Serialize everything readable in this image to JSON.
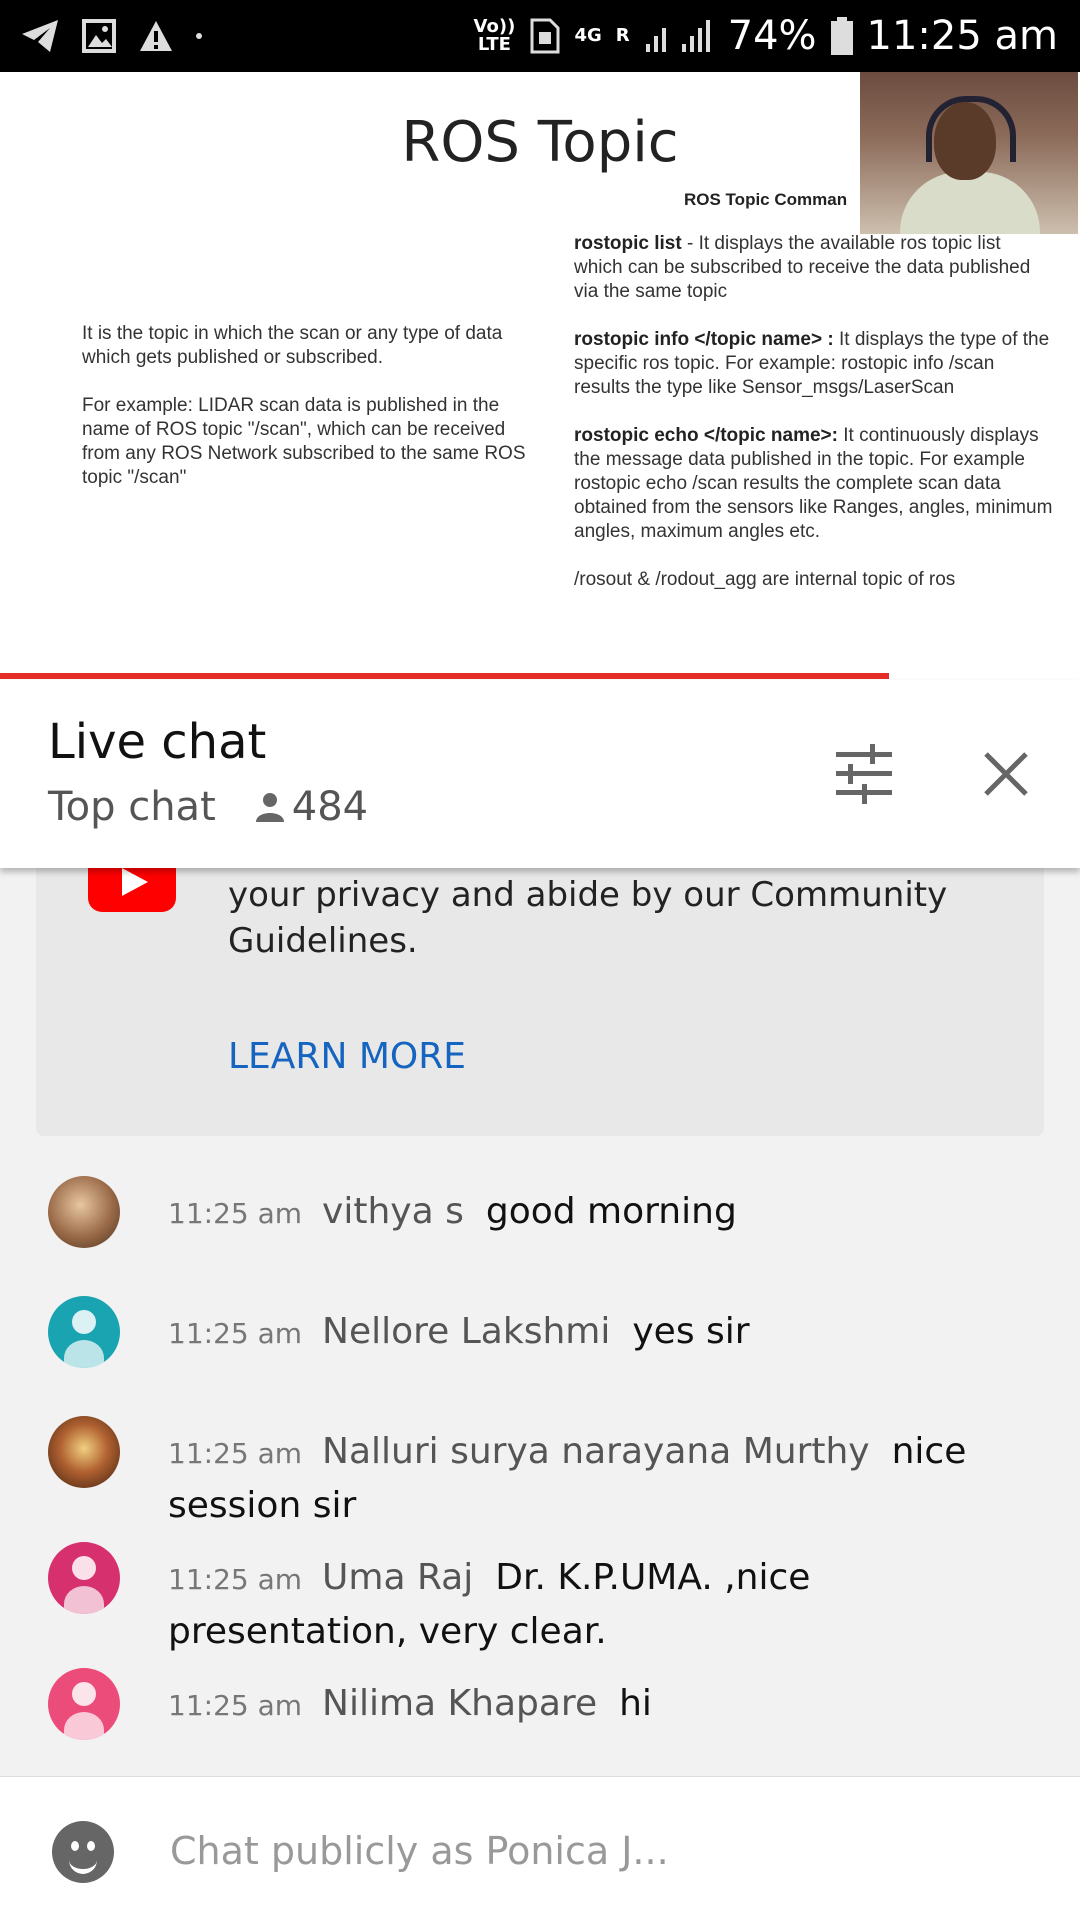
{
  "status_bar": {
    "signal_labels": [
      "Vo)) LTE",
      "4G",
      "R"
    ],
    "battery": "74%",
    "time": "11:25 am"
  },
  "video": {
    "slide_title": "ROS Topic",
    "slide_subhead": "ROS Topic Comman",
    "left_paragraphs": [
      "It is the topic in which the scan or any type of data which gets published or subscribed.",
      "For example: LIDAR scan data is published in the name of ROS topic \"/scan\", which can be received from any ROS Network subscribed to the same ROS topic \"/scan\""
    ],
    "right_items": [
      {
        "cmd": "rostopic list",
        "desc": " - It displays the available ros topic list which can be subscribed to receive the data published via the same topic"
      },
      {
        "cmd": "rostopic info </topic name> :",
        "desc": " It displays the type of the specific ros topic. For example:  rostopic info /scan results the type like Sensor_msgs/LaserScan"
      },
      {
        "cmd": "rostopic echo </topic name>:",
        "desc": " It continuously displays the message data published in the topic. For example rostopic echo /scan results the complete scan data obtained from the sensors like Ranges, angles, minimum angles, maximum angles etc."
      },
      {
        "cmd": "",
        "desc": "/rosout & /rodout_agg are internal topic of ros"
      }
    ],
    "progress_fraction": 0.823
  },
  "chat_header": {
    "title": "Live chat",
    "mode": "Top chat",
    "viewer_count": "484",
    "filter_icon": "sliders-icon",
    "close_icon": "close-icon"
  },
  "welcome": {
    "text": "Welcome to live chat! Remember to guard your privacy and abide by our Community Guidelines.",
    "learn_more": "LEARN MORE"
  },
  "messages": [
    {
      "time": "11:25 am",
      "author": "vithya s",
      "text": "good morning",
      "avatar_color": "#b08060"
    },
    {
      "time": "11:25 am",
      "author": "Nellore Lakshmi",
      "text": "yes sir",
      "avatar_color": "#1aa3b0"
    },
    {
      "time": "11:25 am",
      "author": "Nalluri surya narayana Murthy",
      "text": "nice session sir",
      "avatar_color": "#7a4a2a"
    },
    {
      "time": "11:25 am",
      "author": "Uma Raj",
      "text": "Dr. K.P.UMA. ,nice presentation, very clear.",
      "avatar_color": "#d6306e"
    },
    {
      "time": "11:25 am",
      "author": "Nilima Khapare",
      "text": "hi",
      "avatar_color": "#ec4c7a"
    }
  ],
  "input": {
    "placeholder": "Chat publicly as Ponica J..."
  },
  "colors": {
    "accent_red": "#e52d27",
    "link_blue": "#1565c0"
  }
}
